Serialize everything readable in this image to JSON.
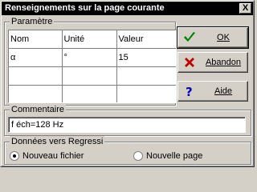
{
  "window": {
    "title": "Renseignements sur la page courante",
    "close_glyph": "X"
  },
  "parametres": {
    "legend": "Paramètre",
    "columns": [
      "Nom",
      "Unité",
      "Valeur"
    ],
    "rows": [
      [
        "α",
        "°",
        "15"
      ],
      [
        "",
        "",
        ""
      ],
      [
        "",
        "",
        ""
      ]
    ]
  },
  "buttons": {
    "ok": {
      "label": "OK",
      "icon": "check-icon",
      "color": "#008000"
    },
    "abandon": {
      "label": "Abandon",
      "icon": "cross-icon",
      "color": "#c00000"
    },
    "aide": {
      "label": "Aide",
      "icon": "question-icon",
      "color": "#0000c0"
    }
  },
  "commentaire": {
    "legend": "Commentaire",
    "value": "f éch=128 Hz"
  },
  "donnees": {
    "legend": "Données vers Regressi",
    "options": [
      {
        "label": "Nouveau fichier",
        "selected": true
      },
      {
        "label": "Nouvelle page",
        "selected": false
      }
    ]
  }
}
